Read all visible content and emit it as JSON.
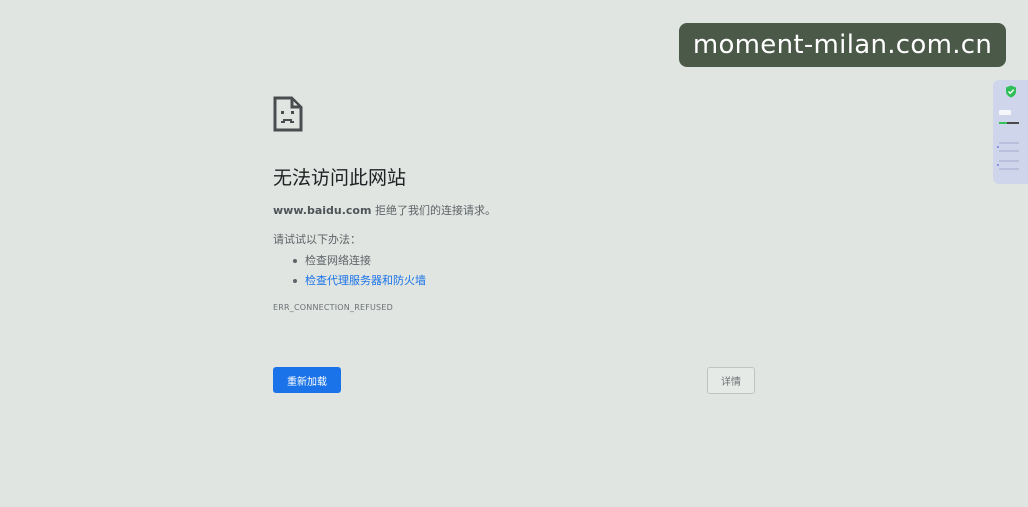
{
  "error": {
    "title": "无法访问此网站",
    "domain": "www.baidu.com",
    "message_suffix": " 拒绝了我们的连接请求。",
    "suggestions_heading": "请试试以下办法：",
    "suggestions": [
      {
        "label": "检查网络连接"
      },
      {
        "label": "检查代理服务器和防火墙"
      }
    ],
    "code": "ERR_CONNECTION_REFUSED"
  },
  "buttons": {
    "reload_label": "重新加载",
    "details_label": "详情"
  },
  "watermark": {
    "text": "moment-milan.com.cn"
  },
  "icons": {
    "error_page": "sad-document-icon",
    "widget_shield": "shield-check-icon"
  },
  "colors": {
    "background": "#e0e5e1",
    "primary_button": "#1a73e8",
    "link": "#1a73e8",
    "watermark_bg": "#4b5948",
    "widget_bg": "#cfd5ea"
  }
}
